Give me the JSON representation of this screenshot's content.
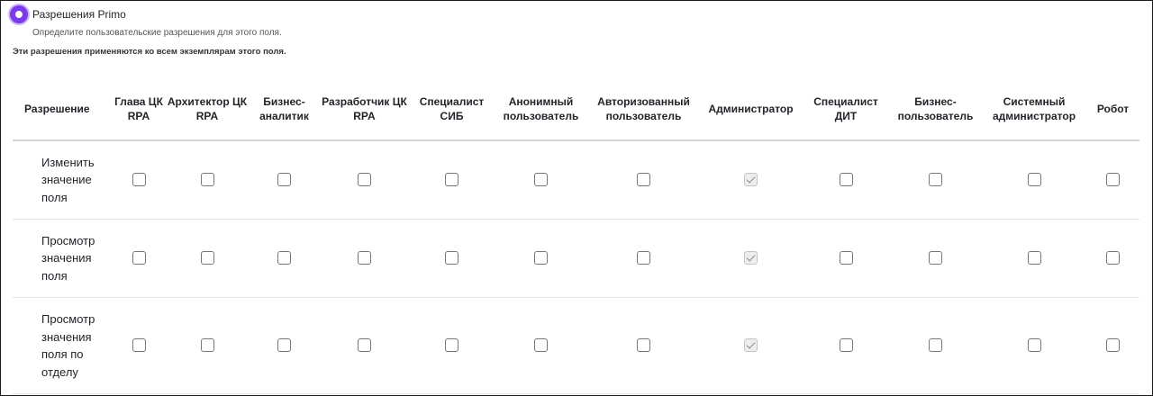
{
  "section": {
    "title": "Разрешения Primo",
    "description": "Определите пользовательские разрешения для этого поля.",
    "notice": "Эти разрешения применяются ко всем экземплярам этого поля."
  },
  "table": {
    "header_first": "Разрешение",
    "roles": [
      "Глава ЦК RPA",
      "Архитектор ЦК RPA",
      "Бизнес-аналитик",
      "Разработчик ЦК RPA",
      "Специалист СИБ",
      "Анонимный пользователь",
      "Авторизованный пользователь",
      "Администратор",
      "Специалист ДИТ",
      "Бизнес-пользователь",
      "Системный администратор",
      "Робот"
    ],
    "rows": [
      {
        "label": "Изменить значение поля",
        "checked": [
          false,
          false,
          false,
          false,
          false,
          false,
          false,
          true,
          false,
          false,
          false,
          false
        ]
      },
      {
        "label": "Просмотр значения поля",
        "checked": [
          false,
          false,
          false,
          false,
          false,
          false,
          false,
          true,
          false,
          false,
          false,
          false
        ]
      },
      {
        "label": "Просмотр значения поля по отделу",
        "checked": [
          false,
          false,
          false,
          false,
          false,
          false,
          false,
          true,
          false,
          false,
          false,
          false
        ]
      }
    ]
  },
  "colors": {
    "accent": "#7c3aed"
  }
}
